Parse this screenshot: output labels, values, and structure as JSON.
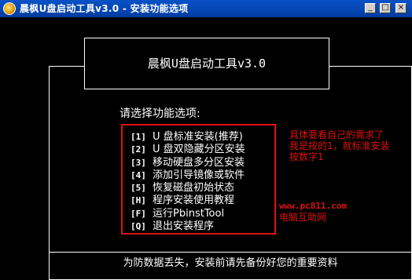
{
  "window": {
    "title": "晨枫U盘启动工具v3.0 - 安装功能选项",
    "buttons": {
      "minimize": "_",
      "maximize": "□",
      "close": "×"
    }
  },
  "header": {
    "app_title": "晨枫U盘启动工具v3.0"
  },
  "main": {
    "prompt": "请选择功能选项:",
    "menu": [
      {
        "key": "[1]",
        "label": "U 盘标准安装(推荐)"
      },
      {
        "key": "[2]",
        "label": "U 盘双隐藏分区安装"
      },
      {
        "key": "[3]",
        "label": "移动硬盘多分区安装"
      },
      {
        "key": "[4]",
        "label": "添加引导镜像或软件"
      },
      {
        "key": "[5]",
        "label": "恢复磁盘初始状态"
      },
      {
        "key": "[H]",
        "label": "程序安装使用教程"
      },
      {
        "key": "[F]",
        "label": "运行PbinstTool"
      },
      {
        "key": "[Q]",
        "label": "退出安装程序"
      }
    ],
    "warning": "为防数据丢失，安装前请先备份好您的重要资料"
  },
  "annotation": {
    "note_lines": [
      "具体要看自己的需求了",
      "我是按的1，就标准安装",
      "按数字1"
    ],
    "url": "www.pc811.com",
    "site": "电脑互助网",
    "color": "#e01010"
  }
}
